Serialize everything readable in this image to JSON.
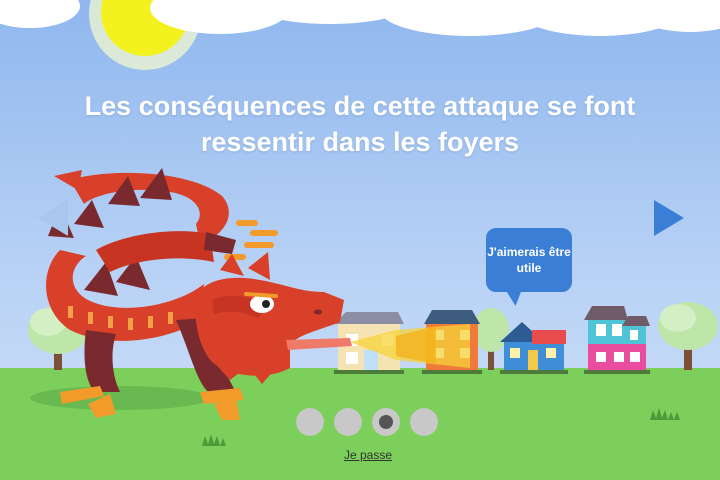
{
  "slide": {
    "title": "Les conséquences de cette attaque se font ressentir dans les foyers",
    "speech_bubble": "J'aimerais être utile"
  },
  "navigation": {
    "prev_icon": "chevron-left-icon",
    "next_icon": "chevron-right-icon",
    "prev_state": "disabled",
    "dots_total": 4,
    "active_dot": 3
  },
  "skip_label": "Je passe",
  "colors": {
    "sky": "#a9c8f3",
    "grass": "#7ccf5a",
    "dragon": "#d9402a",
    "dragon_dark": "#7a2a2e",
    "accent_blue": "#3a7fd5",
    "sun": "#f4f21e"
  }
}
